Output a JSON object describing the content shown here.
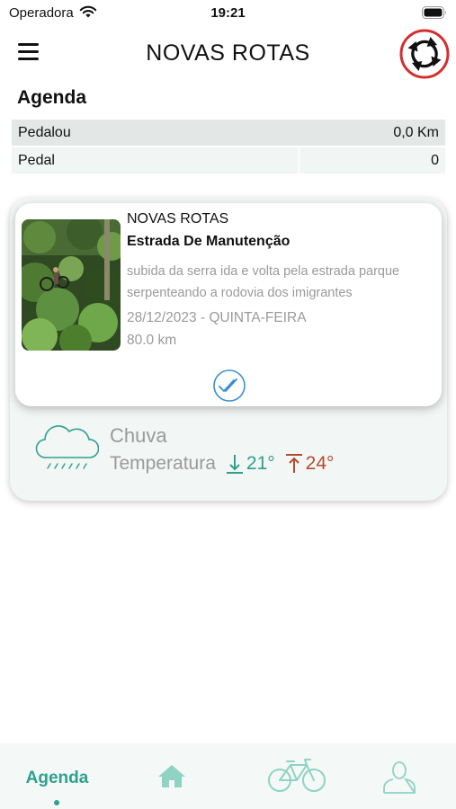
{
  "status_bar": {
    "carrier": "Operadora",
    "time": "19:21"
  },
  "header": {
    "title": "NOVAS ROTAS",
    "menu_icon": "hamburger-menu-icon",
    "logo_icon": "circular-arrows-logo"
  },
  "agenda": {
    "title": "Agenda",
    "rows": [
      {
        "label": "Pedalou",
        "value": "0,0 Km"
      },
      {
        "label": "Pedal",
        "value": "0"
      }
    ]
  },
  "event_card": {
    "label": "NOVAS ROTAS",
    "name": "Estrada De Manutenção",
    "description": "subida da serra ida e volta pela estrada parque serpenteando a rodovia dos imigrantes",
    "date": "28/12/2023 - QUINTA-FEIRA",
    "distance": "80.0 km",
    "confirm_icon": "double-check-circle-icon"
  },
  "weather": {
    "condition": "Chuva",
    "temperature_label": "Temperatura",
    "min": "21°",
    "max": "24°",
    "icon": "rain-cloud-icon"
  },
  "tab_bar": {
    "tabs": [
      {
        "label": "Agenda",
        "active": true
      },
      {
        "icon": "home-icon"
      },
      {
        "icon": "bicycle-icon"
      },
      {
        "icon": "user-icon"
      }
    ]
  },
  "colors": {
    "accent": "#2fa08e",
    "temp_high": "#b24d2c",
    "logo_red": "#d32f2f",
    "muted_text": "#9a9a9a"
  }
}
